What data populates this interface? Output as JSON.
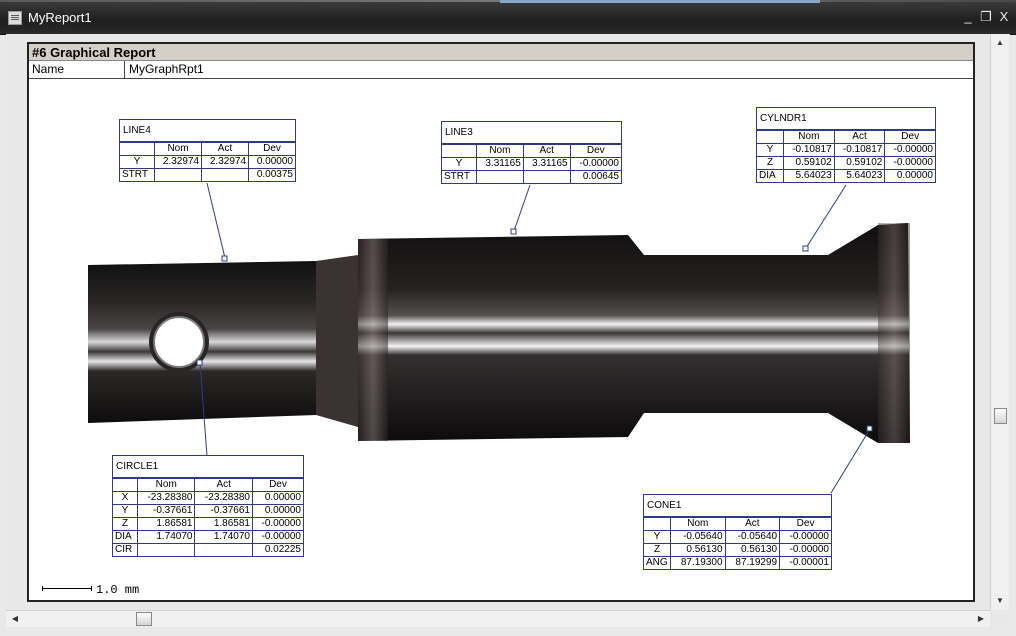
{
  "window": {
    "title": "MyReport1",
    "minimize": "_",
    "restore": "❐",
    "close": "X"
  },
  "report": {
    "header": "#6  Graphical Report",
    "name_label": "Name",
    "name_value": "MyGraphRpt1"
  },
  "scale": {
    "label": "1.0 mm"
  },
  "features": {
    "line4": {
      "title": "LINE4",
      "columns": [
        "",
        "Nom",
        "Act",
        "Dev"
      ],
      "rows": [
        {
          "axis": "Y",
          "nom": "2.32974",
          "act": "2.32974",
          "dev": "0.00000"
        },
        {
          "axis": "STRT",
          "nom": "",
          "act": "",
          "dev": "0.00375"
        }
      ]
    },
    "line3": {
      "title": "LINE3",
      "columns": [
        "",
        "Nom",
        "Act",
        "Dev"
      ],
      "rows": [
        {
          "axis": "Y",
          "nom": "3.31165",
          "act": "3.31165",
          "dev": "-0.00000"
        },
        {
          "axis": "STRT",
          "nom": "",
          "act": "",
          "dev": "0.00645"
        }
      ]
    },
    "cylndr1": {
      "title": "CYLNDR1",
      "columns": [
        "",
        "Nom",
        "Act",
        "Dev"
      ],
      "rows": [
        {
          "axis": "Y",
          "nom": "-0.10817",
          "act": "-0.10817",
          "dev": "-0.00000"
        },
        {
          "axis": "Z",
          "nom": "0.59102",
          "act": "0.59102",
          "dev": "-0.00000"
        },
        {
          "axis": "DIA",
          "nom": "5.64023",
          "act": "5.64023",
          "dev": "0.00000"
        }
      ]
    },
    "circle1": {
      "title": "CIRCLE1",
      "columns": [
        "",
        "Nom",
        "Act",
        "Dev"
      ],
      "rows": [
        {
          "axis": "X",
          "nom": "-23.28380",
          "act": "-23.28380",
          "dev": "0.00000"
        },
        {
          "axis": "Y",
          "nom": "-0.37661",
          "act": "-0.37661",
          "dev": "0.00000"
        },
        {
          "axis": "Z",
          "nom": "1.86581",
          "act": "1.86581",
          "dev": "-0.00000"
        },
        {
          "axis": "DIA",
          "nom": "1.74070",
          "act": "1.74070",
          "dev": "-0.00000"
        },
        {
          "axis": "CIR",
          "nom": "",
          "act": "",
          "dev": "0.02225"
        }
      ]
    },
    "cone1": {
      "title": "CONE1",
      "columns": [
        "",
        "Nom",
        "Act",
        "Dev"
      ],
      "rows": [
        {
          "axis": "Y",
          "nom": "-0.05640",
          "act": "-0.05640",
          "dev": "-0.00000"
        },
        {
          "axis": "Z",
          "nom": "0.56130",
          "act": "0.56130",
          "dev": "-0.00000"
        },
        {
          "axis": "ANG",
          "nom": "87.19300",
          "act": "87.19299",
          "dev": "-0.00001"
        }
      ]
    }
  },
  "colors": {
    "leader": "#2e3a85",
    "part_dark": "#1a1616",
    "highlight": "#f2f2f2"
  }
}
